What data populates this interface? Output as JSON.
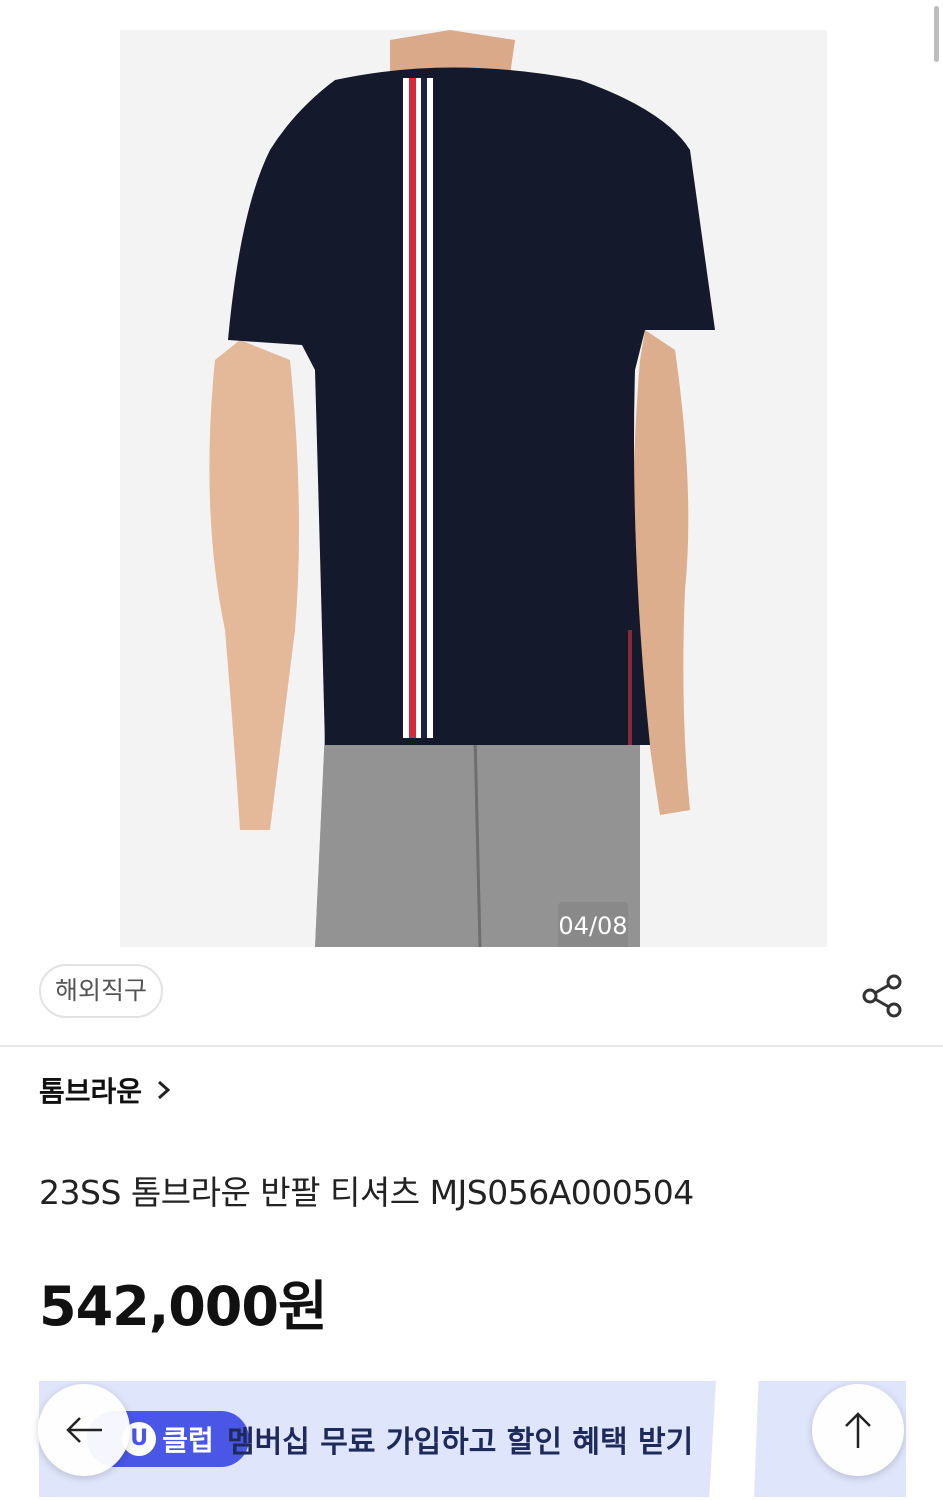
{
  "gallery": {
    "counter": "04/08"
  },
  "product": {
    "tag": "해외직구",
    "brand": "톰브라운",
    "title": "23SS 톰브라운 반팔 티셔츠 MJS056A000504",
    "price": "542,000원"
  },
  "promo": {
    "badge_logo": "U",
    "badge_text": "클럽",
    "text": "멤버십 무료 가입하고 할인 혜택 받기"
  },
  "icons": [
    "share-icon",
    "chevron-right-icon",
    "arrow-left-icon",
    "arrow-up-icon"
  ]
}
